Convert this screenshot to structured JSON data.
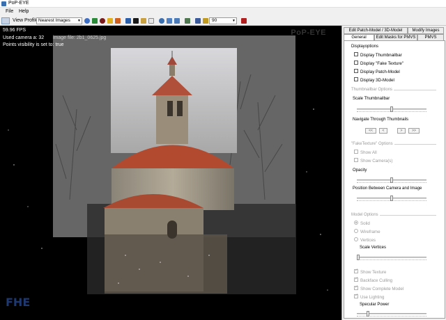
{
  "window": {
    "title": "PoP-EYE"
  },
  "menu": [
    {
      "label": "File"
    },
    {
      "label": "Help"
    }
  ],
  "toolbar": {
    "view_profile_label": "View Profile:",
    "view_profile_value": "Nearest Images",
    "number_value": "90"
  },
  "viewport": {
    "fps": "59.96 FPS",
    "camera_line": "Used camera a: 32",
    "image_file": "image file: 2b1_0625.jpg",
    "visibility_line": "Points visibility is set to: true",
    "logo_top": "PoP-EYE",
    "logo_bottom": "FHE"
  },
  "panel": {
    "tabs_row1": [
      {
        "label": "Edit Patch-Model / 3D-Model"
      },
      {
        "label": "Modify Images"
      }
    ],
    "tabs_row2": [
      {
        "label": "General"
      },
      {
        "label": "Edit Masks for PMVS"
      },
      {
        "label": "PMVS"
      }
    ],
    "display": {
      "title": "Displayoptions",
      "items": [
        {
          "label": "Display Thumbnailbar"
        },
        {
          "label": "Display \"Fake Texture\""
        },
        {
          "label": "Display Patch-Model"
        },
        {
          "label": "Display 3D-Model"
        }
      ]
    },
    "thumbnail": {
      "title": "Thumbnailbar Options",
      "scale_label": "Scale Thumbnailbar",
      "scale_value": 0.5,
      "navigate_label": "Navigate Through Thumbnails",
      "nav_buttons": [
        "<<",
        "<",
        ">",
        ">>"
      ]
    },
    "fake": {
      "title": "\"FakeTexture\" Options",
      "show_all": "Show All",
      "show_cameras": "Show Camera(s)",
      "opacity_label": "Opacity",
      "opacity_value": 0.5,
      "position_label": "Position Between Camera and Image",
      "position_value": 0.5
    },
    "model": {
      "title": "Model Options",
      "modes": [
        {
          "label": "Solid"
        },
        {
          "label": "Wireframe"
        },
        {
          "label": "Vertices"
        }
      ],
      "scale_vertices_label": "Scale Vertices",
      "scale_vertices_value": 0.0,
      "options": [
        {
          "label": "Show Texture"
        },
        {
          "label": "Backface Culling"
        },
        {
          "label": "Show Complete Model"
        },
        {
          "label": "Use Lighting"
        }
      ],
      "specular_label": "Specular Power",
      "specular_value": 0.15
    }
  }
}
